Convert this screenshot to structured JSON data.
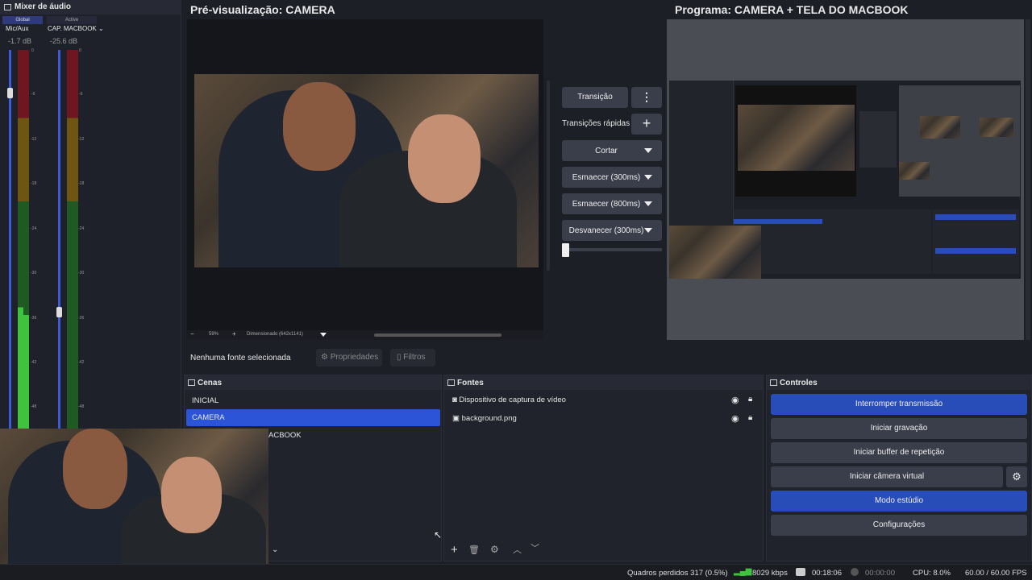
{
  "mixer": {
    "title": "Mixer de áudio",
    "tab_global": "Global",
    "tab_active": "Active",
    "channels": [
      {
        "name": "Mic/Aux",
        "db": "-1.7 dB"
      },
      {
        "name": "CAP. MACBOOK",
        "db": "-25.6 dB"
      }
    ],
    "ticks": [
      "0",
      "-6",
      "-12",
      "-18",
      "-24",
      "-30",
      "-36",
      "-42",
      "-48"
    ]
  },
  "preview": {
    "title": "Pré-visualização: CAMERA",
    "zoom": "59%",
    "zoom_minus": "−",
    "zoom_plus": "+",
    "scale_label": "Dimensionado (642x1141)"
  },
  "program": {
    "title": "Programa: CAMERA + TELA DO MACBOOK"
  },
  "transitions": {
    "transition_button": "Transição",
    "quick_label": "Transições rápidas",
    "items": [
      "Cortar",
      "Esmaecer (300ms)",
      "Esmaecer (800ms)",
      "Desvanecer (300ms)"
    ]
  },
  "source_bar": {
    "no_source": "Nenhuma fonte selecionada",
    "properties": "Propriedades",
    "filters": "Filtros"
  },
  "scenes": {
    "title": "Cenas",
    "items": [
      "INICIAL",
      "CAMERA",
      "ACBOOK"
    ]
  },
  "sources": {
    "title": "Fontes",
    "items": [
      "Dispositivo de captura de vídeo",
      "background.png"
    ]
  },
  "controls": {
    "title": "Controles",
    "stop_stream": "Interromper transmissão",
    "start_recording": "Iniciar gravação",
    "start_replay": "Iniciar buffer de repetição",
    "start_virtual_cam": "Iniciar câmera virtual",
    "studio_mode": "Modo estúdio",
    "settings": "Configurações"
  },
  "status_bar": {
    "dropped_frames": "Quadros perdidos 317 (0.5%)",
    "bitrate": "8029 kbps",
    "live_time": "00:18:06",
    "rec_time": "00:00:00",
    "cpu": "CPU: 8.0%",
    "fps": "60.00 / 60.00 FPS"
  },
  "colors": {
    "accent": "#284cb8",
    "selected_row": "#2b54d6",
    "meter_green": "#3fc33f",
    "meter_yellow": "#c9a21d",
    "meter_red": "#b8232f"
  }
}
